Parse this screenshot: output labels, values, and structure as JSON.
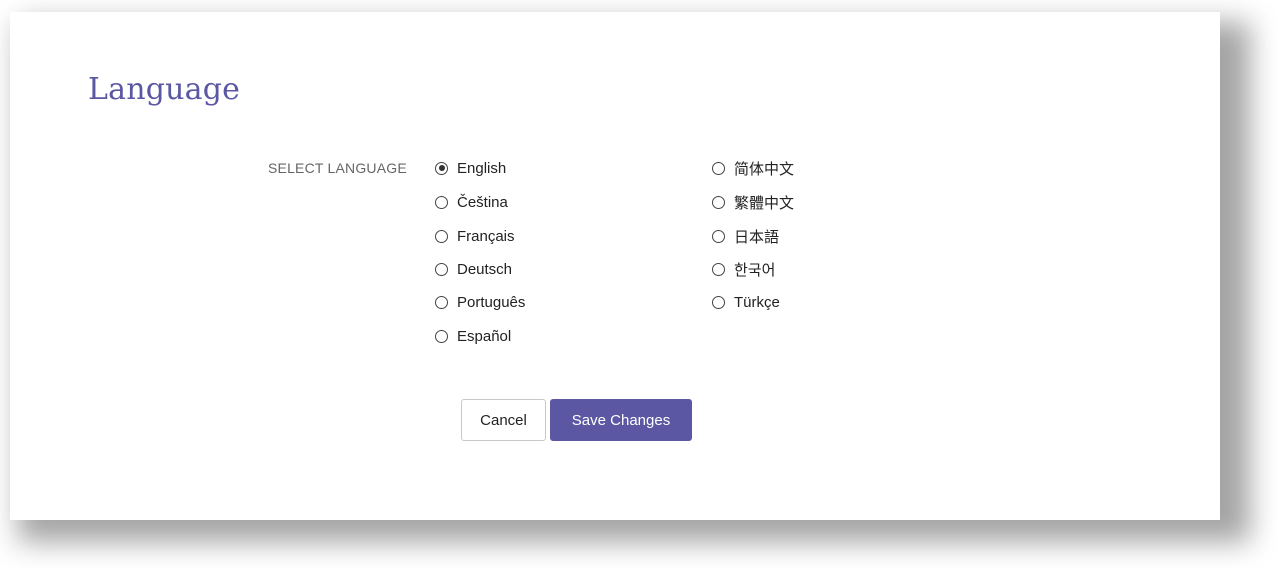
{
  "page": {
    "title": "Language",
    "select_label": "SELECT LANGUAGE"
  },
  "languages": {
    "left": [
      {
        "label": "English",
        "selected": true
      },
      {
        "label": "Čeština",
        "selected": false
      },
      {
        "label": "Français",
        "selected": false
      },
      {
        "label": "Deutsch",
        "selected": false
      },
      {
        "label": "Português",
        "selected": false
      },
      {
        "label": "Español",
        "selected": false
      }
    ],
    "right": [
      {
        "label": "简体中文",
        "selected": false
      },
      {
        "label": "繁體中文",
        "selected": false
      },
      {
        "label": "日本語",
        "selected": false
      },
      {
        "label": "한국어",
        "selected": false
      },
      {
        "label": "Türkçe",
        "selected": false
      }
    ]
  },
  "buttons": {
    "cancel": "Cancel",
    "save": "Save Changes"
  },
  "colors": {
    "accent": "#5b57a3",
    "label_gray": "#666666"
  }
}
